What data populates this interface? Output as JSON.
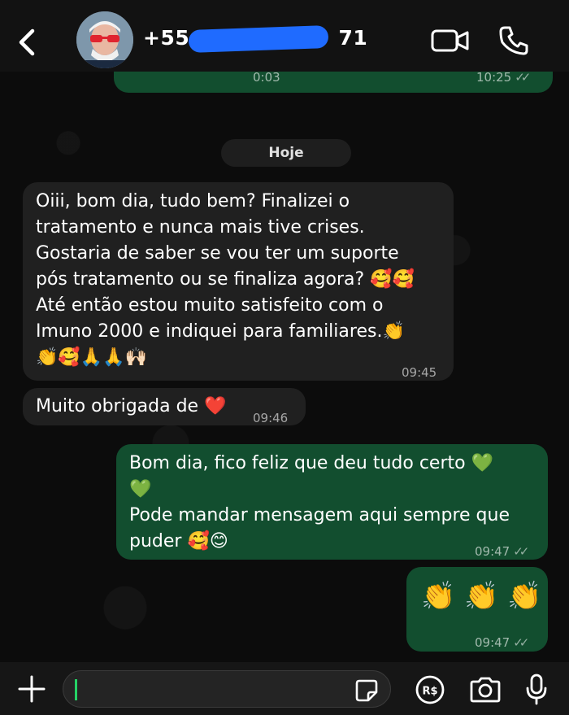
{
  "header": {
    "contact_name": "+55 ",
    "contact_name_visible_end": "71",
    "avatar_label": "contact photo"
  },
  "top_message": {
    "duration": "0:03",
    "time": "10:25"
  },
  "date_divider": "Hoje",
  "messages": [
    {
      "direction": "in",
      "text": "Oiii, bom dia, tudo bem? Finalizei o\ntratamento e nunca mais tive crises.\nGostaria de saber se vou ter um suporte\npós tratamento ou se finaliza agora? 🥰🥰\nAté então estou muito satisfeito com o\nImuno 2000 e indiquei para familiares.👏\n👏🥰🙏🙏🙌🏻",
      "time": "09:45"
    },
    {
      "direction": "in",
      "text": "Muito obrigada de ❤️",
      "time": "09:46"
    },
    {
      "direction": "out",
      "text": "Bom dia, fico feliz que deu tudo certo 💚\n💚\nPode mandar mensagem aqui sempre que\npuder 🥰😊",
      "time": "09:47"
    },
    {
      "direction": "out",
      "text": "👏 👏 👏",
      "time": "09:47"
    }
  ],
  "footer": {
    "input_placeholder": ""
  },
  "colors": {
    "outgoing_bubble": "#124e2f",
    "incoming_bubble": "#202020",
    "accent": "#25d366"
  }
}
